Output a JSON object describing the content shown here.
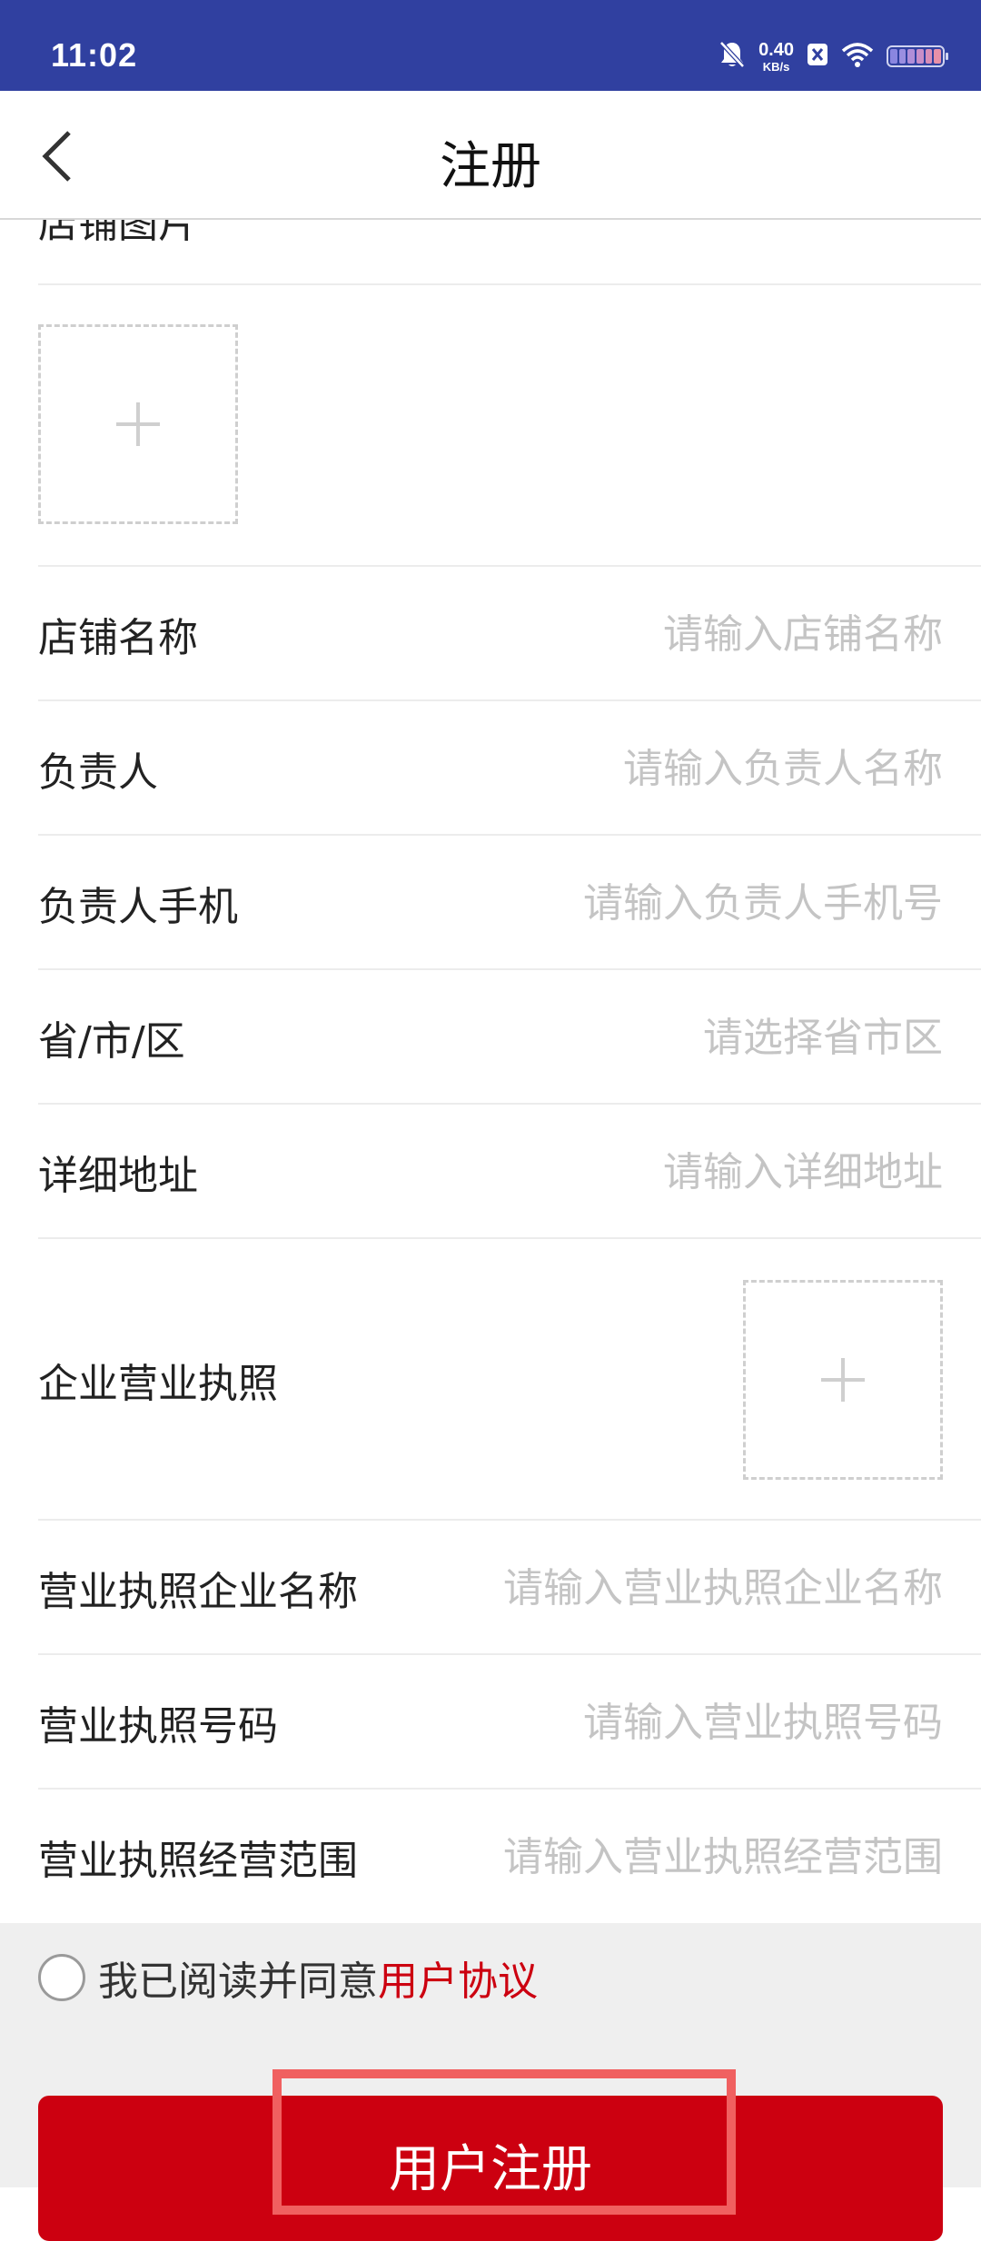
{
  "status_bar": {
    "time": "11:02",
    "net_speed_value": "0.40",
    "net_speed_unit": "KB/s",
    "icons": [
      "bell-off-icon",
      "x-badge-icon",
      "wifi-icon",
      "battery-icon"
    ],
    "background_color": "#3040a0"
  },
  "nav": {
    "title": "注册",
    "back_icon": "chevron-left-icon"
  },
  "form": {
    "shop_photo_label": "店铺图片",
    "rows": [
      {
        "label": "店铺名称",
        "placeholder": "请输入店铺名称",
        "value": ""
      },
      {
        "label": "负责人",
        "placeholder": "请输入负责人名称",
        "value": ""
      },
      {
        "label": "负责人手机",
        "placeholder": "请输入负责人手机号",
        "value": ""
      },
      {
        "label": "省/市/区",
        "placeholder": "请选择省市区",
        "value": ""
      },
      {
        "label": "详细地址",
        "placeholder": "请输入详细地址",
        "value": ""
      }
    ],
    "license_label": "企业营业执照",
    "license_rows": [
      {
        "label": "营业执照企业名称",
        "placeholder": "请输入营业执照企业名称",
        "value": ""
      },
      {
        "label": "营业执照号码",
        "placeholder": "请输入营业执照号码",
        "value": ""
      },
      {
        "label": "营业执照经营范围",
        "placeholder": "请输入营业执照经营范围",
        "value": ""
      }
    ]
  },
  "footer": {
    "agree_text": "我已阅读并同意",
    "agree_link": "用户协议",
    "register_label": "用户注册",
    "accent_color": "#cc0010"
  }
}
